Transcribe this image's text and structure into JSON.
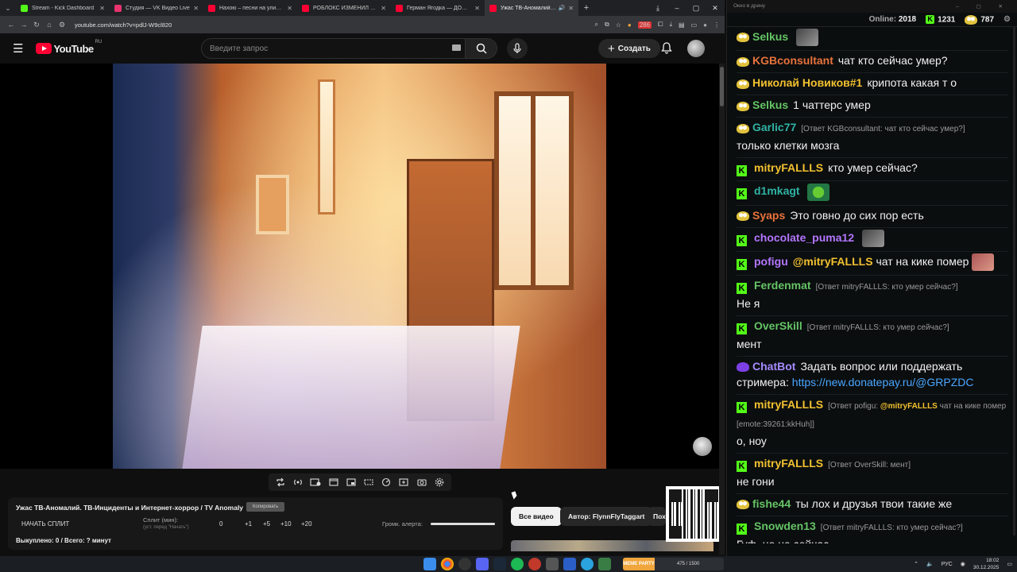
{
  "browser": {
    "tabs": [
      {
        "title": "Stream - Kick Dashboard",
        "color": "#53fc18"
      },
      {
        "title": "Студия — VK Видео Live",
        "color": "#e8336e"
      },
      {
        "title": "Нахою – песни на улицах, арена",
        "color": "#ff0033"
      },
      {
        "title": "РОБЛОКС ИЗМЕНИЛ ВСЮ МОЮ",
        "color": "#ff0033"
      },
      {
        "title": "Герман Ягодка — ДОМ 2 и альтернатива",
        "color": "#ff0033"
      },
      {
        "title": "Ужас ТВ-Аномалий. ТВ-Инц",
        "color": "#ff0033",
        "active": true
      }
    ],
    "url": "youtube.com/watch?v=pdlJ-W9cl820",
    "ext_badge": "286"
  },
  "youtube": {
    "logo_text": "YouTube",
    "region": "RU",
    "search_placeholder": "Введите запрос",
    "create_label": "Создать"
  },
  "split_panel": {
    "title": "Ужас ТВ-Аномалий. ТВ-Инциденты и Интернет-хоррор / TV Anomaly",
    "copy_label": "Копировать",
    "start_label": "НАЧАТЬ СПЛИТ",
    "split_label": "Сплит (мин):",
    "split_hint": "(уст. перед \"Начать\")",
    "split_value": "0",
    "increments": [
      "+1",
      "+5",
      "+10",
      "+20"
    ],
    "alert_label": "Громк. алерта:",
    "alert_volume": 1.0,
    "bought_text": "Выкуплено: 0 / Всего: ? минут"
  },
  "chips": {
    "all": "Все видео",
    "author": "Автор: FlynnFlyTaggart",
    "third": "Пох"
  },
  "chat": {
    "window_title": "Окно в дрину",
    "online_label": "Online:",
    "online_value": "2018",
    "kick_count": "1231",
    "other_count": "787",
    "messages": [
      {
        "badge": "pepe",
        "user": "Selkus",
        "color": "#65c466",
        "text": "",
        "emote": true
      },
      {
        "badge": "pepe",
        "user": "KGBconsultant",
        "color": "#e8733c",
        "text": "чат кто сейчас умер?"
      },
      {
        "badge": "pepe",
        "user": "Николай Новиков#1",
        "color": "#f2c130",
        "text": "крипота какая т о"
      },
      {
        "badge": "pepe",
        "user": "Selkus",
        "color": "#65c466",
        "text": "1 чаттерс умер"
      },
      {
        "badge": "pepe",
        "user": "Garlic77",
        "color": "#2fb3a4",
        "reply_to": "KGBconsultant",
        "reply_text": "чат кто сейчас умер?",
        "text": "только клетки мозга"
      },
      {
        "badge": "kick",
        "user": "mitryFALLLS",
        "color": "#f2c130",
        "text": "кто умер сейчас?"
      },
      {
        "badge": "kick",
        "user": "d1mkagt",
        "color": "#2fb3a4",
        "text": "",
        "emote": true
      },
      {
        "badge": "pepe",
        "user": "Syaps",
        "color": "#e8733c",
        "text": "Это говно до сих пор есть"
      },
      {
        "badge": "kick",
        "user": "chocolate_puma12",
        "color": "#b276ff",
        "text": "",
        "emote": true
      },
      {
        "badge": "kick",
        "user": "pofigu",
        "color": "#b276ff",
        "mention": "@mitryFALLLS",
        "text": "чат на кике помер",
        "emote": true
      },
      {
        "badge": "kick",
        "user": "Ferdenmat",
        "color": "#65c466",
        "reply_to": "mitryFALLLS",
        "reply_text": "кто умер сейчас?",
        "text": "Не я"
      },
      {
        "badge": "kick",
        "user": "OverSkill",
        "color": "#65c466",
        "reply_to": "mitryFALLLS",
        "reply_text": "кто умер сейчас?",
        "text": "мент"
      },
      {
        "badge": "bot",
        "user": "ChatBot",
        "color": "#a58bff",
        "text": "Задать вопрос или поддержать стримера:",
        "link": "https://new.donatepay.ru/@GRPZDC"
      },
      {
        "badge": "kick",
        "user": "mitryFALLLS",
        "color": "#f2c130",
        "reply_to": "pofigu",
        "reply_mention": "@mitryFALLLS",
        "reply_text": "чат на кике помер [emote:39261:kkHuh]",
        "text": "о, ноу"
      },
      {
        "badge": "kick",
        "user": "mitryFALLLS",
        "color": "#f2c130",
        "reply_to": "OverSkill",
        "reply_text": "мент",
        "text": "не гони"
      },
      {
        "badge": "pepe",
        "user": "fishe44",
        "color": "#65c466",
        "text": "ты лох и друзья твои такие же"
      },
      {
        "badge": "kick",
        "user": "Snowden13",
        "color": "#65c466",
        "reply_to": "mitryFALLLS",
        "reply_text": "кто умер сейчас?",
        "text": "Гуф, но не сейчас"
      }
    ]
  },
  "taskbar": {
    "media_label": "MEME PARTY",
    "media_counter": "475 / 1500",
    "lang": "РУС",
    "time": "18:02",
    "date": "30.12.2025"
  }
}
